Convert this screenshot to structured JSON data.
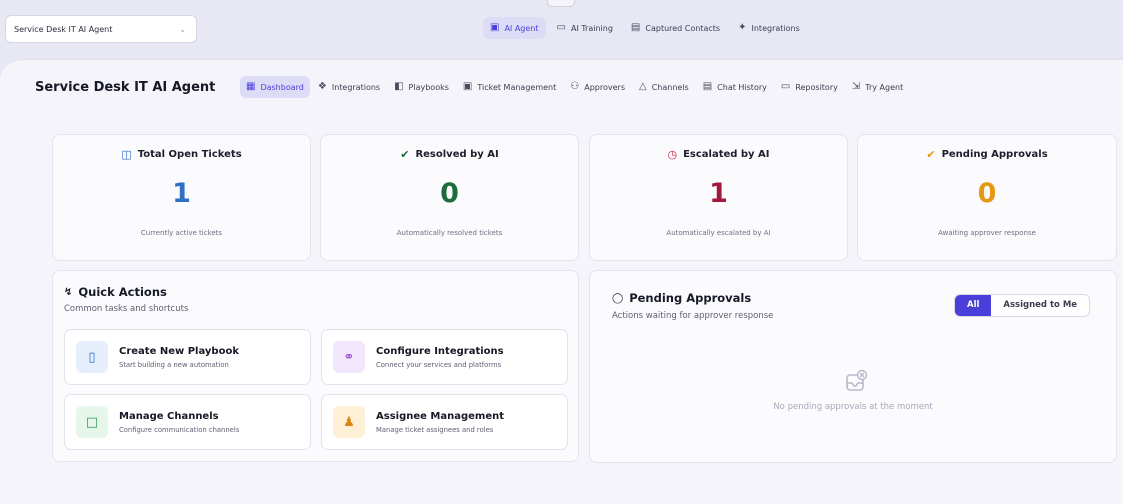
{
  "window": {
    "notch_glyph": "^"
  },
  "agent_select": {
    "value": "Service Desk IT AI Agent"
  },
  "top_tabs": [
    {
      "label": "AI Agent",
      "icon": "ai-agent-icon",
      "active": true
    },
    {
      "label": "AI Training",
      "icon": "training-icon",
      "active": false
    },
    {
      "label": "Captured Contacts",
      "icon": "contacts-icon",
      "active": false
    },
    {
      "label": "Integrations",
      "icon": "integrations-icon",
      "active": false
    }
  ],
  "page": {
    "title": "Service Desk IT AI Agent"
  },
  "sub_tabs": [
    {
      "label": "Dashboard",
      "icon": "grid-icon",
      "active": true
    },
    {
      "label": "Integrations",
      "icon": "puzzle-icon",
      "active": false
    },
    {
      "label": "Playbooks",
      "icon": "playbook-icon",
      "active": false
    },
    {
      "label": "Ticket Management",
      "icon": "ticket-icon",
      "active": false
    },
    {
      "label": "Approvers",
      "icon": "approvers-icon",
      "active": false
    },
    {
      "label": "Channels",
      "icon": "channels-icon",
      "active": false
    },
    {
      "label": "Chat History",
      "icon": "chat-icon",
      "active": false
    },
    {
      "label": "Repository",
      "icon": "repository-icon",
      "active": false
    },
    {
      "label": "Try Agent",
      "icon": "try-icon",
      "active": false
    }
  ],
  "stats": [
    {
      "title": "Total Open Tickets",
      "value": "1",
      "subtitle": "Currently active tickets",
      "color": "#2f6fc4",
      "icon": "book-icon"
    },
    {
      "title": "Resolved by AI",
      "value": "0",
      "subtitle": "Automatically resolved tickets",
      "color": "#1c6b3a",
      "icon": "check-circle-icon"
    },
    {
      "title": "Escalated by AI",
      "value": "1",
      "subtitle": "Automatically escalated by AI",
      "color": "#a3183a",
      "icon": "clock-icon"
    },
    {
      "title": "Pending Approvals",
      "value": "0",
      "subtitle": "Awaiting approver response",
      "color": "#e39a12",
      "icon": "check-circle-icon"
    }
  ],
  "quick_actions": {
    "title": "Quick Actions",
    "subtitle": "Common tasks and shortcuts",
    "items": [
      {
        "title": "Create New Playbook",
        "subtitle": "Start building a new automation",
        "icon": "new-playbook-icon",
        "icon_bg": "#e6eefc",
        "icon_color": "#2f6fc4"
      },
      {
        "title": "Configure Integrations",
        "subtitle": "Connect your services and platforms",
        "icon": "link-icon",
        "icon_bg": "#f1e6fb",
        "icon_color": "#9a4fd6"
      },
      {
        "title": "Manage Channels",
        "subtitle": "Configure communication channels",
        "icon": "message-icon",
        "icon_bg": "#e6f6ea",
        "icon_color": "#2a9a4c"
      },
      {
        "title": "Assignee Management",
        "subtitle": "Manage ticket assignees and roles",
        "icon": "user-icon",
        "icon_bg": "#fdf0d6",
        "icon_color": "#d9850f"
      }
    ]
  },
  "pending_approvals": {
    "title": "Pending Approvals",
    "subtitle": "Actions waiting for approver response",
    "filters": [
      {
        "label": "All",
        "active": true
      },
      {
        "label": "Assigned to Me",
        "active": false
      }
    ],
    "empty_text": "No pending approvals at the moment"
  }
}
